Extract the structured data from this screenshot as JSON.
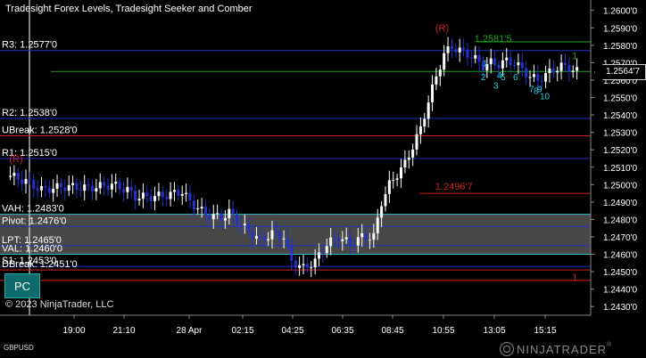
{
  "title": "Tradesight Forex Levels, Tradesight Seeker and Comber",
  "symbol": "GBPUSD",
  "copyright": "© 2023 NinjaTrader, LLC",
  "brand": "NINJATRADER",
  "trademark": "®",
  "pc_button": "PC",
  "current_price": "1.2564'7",
  "colors": {
    "background": "#000000",
    "up_bar": "#ffffff",
    "down_bar": "#2233cc",
    "level_blue": "#2030c0",
    "level_red": "#d02020",
    "level_cyan": "#30c0c0",
    "value_area": "#555555",
    "green": "#20a020",
    "seeker_cyan": "#20d0e0"
  },
  "y_axis": {
    "ticks": [
      "1.2600'0",
      "1.2590'0",
      "1.2580'0",
      "1.2570'0",
      "1.2560'0",
      "1.2550'0",
      "1.2540'0",
      "1.2530'0",
      "1.2520'0",
      "1.2510'0",
      "1.2500'0",
      "1.2490'0",
      "1.2480'0",
      "1.2470'0",
      "1.2460'0",
      "1.2450'0",
      "1.2440'0",
      "1.2430'0"
    ]
  },
  "x_axis": {
    "ticks": [
      "19:00",
      "21:10",
      "28 Apr",
      "02:15",
      "04:25",
      "06:35",
      "08:45",
      "10:55",
      "13:05",
      "15:15"
    ]
  },
  "levels": [
    {
      "label": "R3: 1.2577'0",
      "price": 1.2577,
      "color": "level_blue"
    },
    {
      "label": "R2: 1.2538'0",
      "price": 1.2538,
      "color": "level_blue"
    },
    {
      "label": "UBreak: 1.2528'0",
      "price": 1.2528,
      "color": "level_red"
    },
    {
      "label": "R1: 1.2515'0",
      "price": 1.2515,
      "color": "level_blue"
    },
    {
      "label": "VAH: 1.2483'0",
      "price": 1.2483,
      "color": "level_cyan"
    },
    {
      "label": "Pivot: 1.2476'0",
      "price": 1.2476,
      "color": "level_blue"
    },
    {
      "label": "LPT: 1.2465'0",
      "price": 1.2465,
      "color": "level_blue"
    },
    {
      "label": "VAL: 1.2460'0",
      "price": 1.246,
      "color": "level_cyan"
    },
    {
      "label": "S1: 1.2453'0",
      "price": 1.2453,
      "color": "level_blue"
    },
    {
      "label": "DBreak: 1.2451'0",
      "price": 1.2451,
      "color": "level_red"
    },
    {
      "label": "",
      "price": 1.2445,
      "color": "level_red"
    }
  ],
  "annotations": [
    {
      "text": "(R)",
      "price": 1.2588,
      "bar": 110,
      "color": "level_red"
    },
    {
      "text": "(R)",
      "price": 1.2513,
      "bar": 1,
      "color": "level_red"
    },
    {
      "text": "1.2581'5",
      "price": 1.2582,
      "bar": 120,
      "color": "green"
    },
    {
      "text": "1.2496'7",
      "price": 1.2497,
      "bar": 110,
      "color": "level_red"
    },
    {
      "text": "1",
      "price": 1.2572,
      "bar": 145,
      "color": "green"
    },
    {
      "text": "1",
      "price": 1.2445,
      "bar": 145,
      "color": "level_red"
    }
  ],
  "seeker_numbers": [
    "1",
    "2",
    "3",
    "4",
    "5",
    "6",
    "7",
    "8",
    "9",
    "10"
  ],
  "chart_data": {
    "type": "candlestick",
    "price_range": [
      1.2425,
      1.2606
    ],
    "bars": 146,
    "close_path": [
      [
        0,
        1.2505
      ],
      [
        4,
        1.2502
      ],
      [
        8,
        1.2497
      ],
      [
        14,
        1.2499
      ],
      [
        20,
        1.2498
      ],
      [
        26,
        1.25
      ],
      [
        30,
        1.2497
      ],
      [
        32,
        1.2493
      ],
      [
        36,
        1.2493
      ],
      [
        40,
        1.2494
      ],
      [
        44,
        1.2496
      ],
      [
        46,
        1.249
      ],
      [
        50,
        1.2483
      ],
      [
        54,
        1.2481
      ],
      [
        56,
        1.2484
      ],
      [
        60,
        1.2475
      ],
      [
        64,
        1.2468
      ],
      [
        67,
        1.2472
      ],
      [
        70,
        1.247
      ],
      [
        72,
        1.2456
      ],
      [
        75,
        1.2452
      ],
      [
        78,
        1.2456
      ],
      [
        81,
        1.2466
      ],
      [
        84,
        1.247
      ],
      [
        87,
        1.2466
      ],
      [
        90,
        1.247
      ],
      [
        93,
        1.247
      ],
      [
        95,
        1.249
      ],
      [
        97,
        1.25
      ],
      [
        99,
        1.2506
      ],
      [
        101,
        1.2512
      ],
      [
        103,
        1.2522
      ],
      [
        105,
        1.2532
      ],
      [
        107,
        1.2548
      ],
      [
        109,
        1.2562
      ],
      [
        111,
        1.2575
      ],
      [
        113,
        1.2579
      ],
      [
        115,
        1.2577
      ],
      [
        117,
        1.2575
      ],
      [
        119,
        1.2572
      ],
      [
        121,
        1.2568
      ],
      [
        123,
        1.257
      ],
      [
        125,
        1.2569
      ],
      [
        127,
        1.2571
      ],
      [
        129,
        1.257
      ],
      [
        131,
        1.2566
      ],
      [
        133,
        1.2562
      ],
      [
        135,
        1.256
      ],
      [
        137,
        1.2563
      ],
      [
        139,
        1.2566
      ],
      [
        141,
        1.2568
      ],
      [
        143,
        1.2567
      ],
      [
        145,
        1.2565
      ]
    ]
  }
}
